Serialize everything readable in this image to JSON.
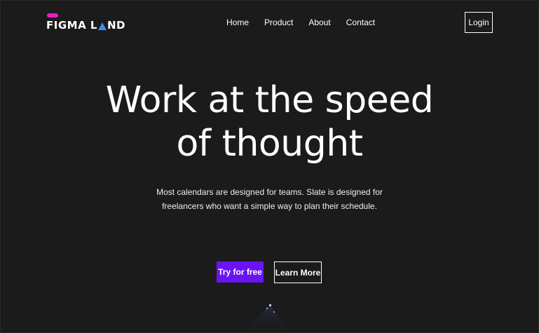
{
  "brand": {
    "name_part1": "FIGMA L",
    "name_part2": "ND",
    "pill_color": "#e11fc6",
    "triangle_color": "#3b8bf0"
  },
  "nav": {
    "items": [
      {
        "label": "Home"
      },
      {
        "label": "Product"
      },
      {
        "label": "About"
      },
      {
        "label": "Contact"
      }
    ],
    "login_label": "Login"
  },
  "hero": {
    "title_line1": "Work at the speed",
    "title_line2": "of thought",
    "subtitle_line1": "Most calendars are designed for teams. Slate is designed for",
    "subtitle_line2": "freelancers who want a simple way to plan their schedule.",
    "primary_cta": "Try for free",
    "secondary_cta": "Learn More"
  },
  "colors": {
    "background": "#1c1b1c",
    "accent": "#6a13f5"
  }
}
